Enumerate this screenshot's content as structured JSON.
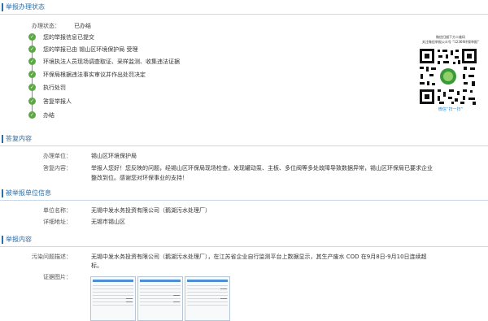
{
  "sections": {
    "report_status": "举报办理状态",
    "reply": "答复内容",
    "reported_unit": "被举报单位信息",
    "report_content": "举报内容"
  },
  "status": {
    "label": "办理状态：",
    "value": "已办结"
  },
  "timeline": [
    "您的举报信息已提交",
    "您的举报已由 锡山区环境保护局 受理",
    "环境执法人员现场调查取证、采样监测、收集违法证据",
    "环保局根据违法事实审议并作出处罚决定",
    "执行处罚",
    "答复举报人",
    "办结"
  ],
  "qr": {
    "caption_line1": "微信扫描下方二维码",
    "caption_line2": "关注微信举报公众号 “12369环保举报”",
    "scan_label": "微信“扫一扫”"
  },
  "reply": {
    "unit_label": "办理单位：",
    "unit_value": "锡山区环境保护局",
    "content_label": "答复内容：",
    "content_line1": "举报人您好！您反映的问题，经锡山区环保局现场检查，发现罐动泵、主板、多位阀等多处故障导致数据异常，锡山区环保局已要求企业",
    "content_line2": "整改到位。感谢您对环保事业的支持！"
  },
  "reported_unit": {
    "name_label": "单位名称：",
    "name_value": "无锡中发水务投资有限公司（鹅湖污水处理厂）",
    "address_label": "详细地址：",
    "address_value": "无锡市锡山区"
  },
  "report": {
    "problem_label": "污染问题描述：",
    "problem_line1": "无锡中发水务投资有限公司（鹅湖污水处理厂），在江苏省企业自行监测平台上数据显示，其生产废水 COD 在9月8日-9月10日连续超",
    "problem_line2": "标。",
    "evidence_label": "证据图片："
  },
  "colors": {
    "accent": "#2e6ea6",
    "timeline_green": "#5ca844"
  },
  "icons": {
    "timeline_step": "check-icon"
  }
}
